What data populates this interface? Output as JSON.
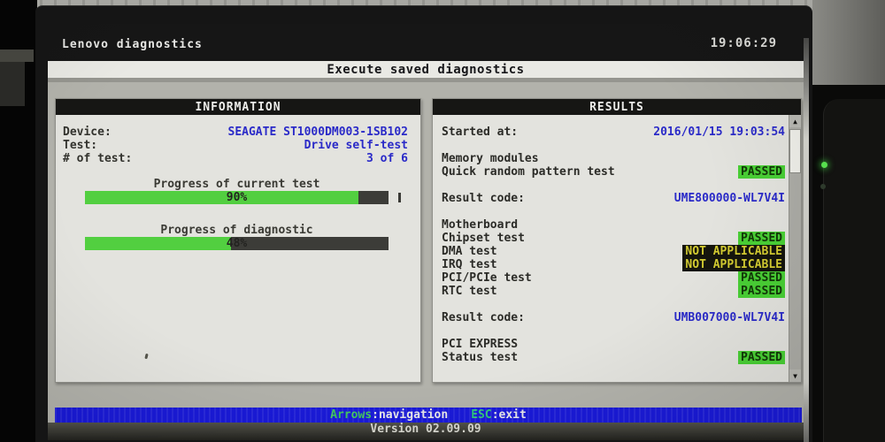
{
  "titlebar": {
    "app": "Lenovo diagnostics",
    "clock": "19:06:29"
  },
  "menu_title": "Execute saved diagnostics",
  "information": {
    "header": "INFORMATION",
    "fields": [
      {
        "label": "Device:",
        "value": "SEAGATE ST1000DM003-1SB102"
      },
      {
        "label": "Test:",
        "value": "Drive self-test"
      },
      {
        "label": "# of test:",
        "value": "3 of 6"
      }
    ],
    "progress_bars": [
      {
        "label": "Progress of current test",
        "percent": 90,
        "text": "90%"
      },
      {
        "label": "Progress of diagnostic",
        "percent": 48,
        "text": "48%"
      }
    ]
  },
  "results": {
    "header": "RESULTS",
    "rows": [
      {
        "type": "field",
        "label": "Started at:",
        "value": "2016/01/15 19:03:54"
      },
      {
        "type": "group",
        "label": "Memory modules"
      },
      {
        "type": "test",
        "label": "Quick random pattern test",
        "status": "PASSED"
      },
      {
        "type": "field",
        "label": "Result code:",
        "value": "UME800000-WL7V4I"
      },
      {
        "type": "group",
        "label": "Motherboard"
      },
      {
        "type": "test",
        "label": "Chipset test",
        "status": "PASSED"
      },
      {
        "type": "test",
        "label": "DMA test",
        "status": "NOT APPLICABLE"
      },
      {
        "type": "test",
        "label": "IRQ test",
        "status": "NOT APPLICABLE"
      },
      {
        "type": "test",
        "label": "PCI/PCIe test",
        "status": "PASSED"
      },
      {
        "type": "test",
        "label": "RTC test",
        "status": "PASSED"
      },
      {
        "type": "field",
        "label": "Result code:",
        "value": "UMB007000-WL7V4I"
      },
      {
        "type": "group",
        "label": "PCI EXPRESS"
      },
      {
        "type": "test",
        "label": "Status test",
        "status": "PASSED"
      }
    ],
    "scroll_icons": {
      "up": "▲",
      "down": "▼"
    }
  },
  "footer": {
    "separator": ":",
    "keys": [
      {
        "key": "Arrows",
        "action": "navigation"
      },
      {
        "key": "ESC",
        "action": "exit"
      }
    ],
    "version": "Version 02.09.09"
  },
  "colors": {
    "accent_blue": "#2a2ac8",
    "progress_green": "#52cf40",
    "passed_bg": "#49cf35",
    "na_text": "#d3cb31",
    "footer_bar": "#1a1ad8",
    "key_green": "#3ec75a"
  }
}
